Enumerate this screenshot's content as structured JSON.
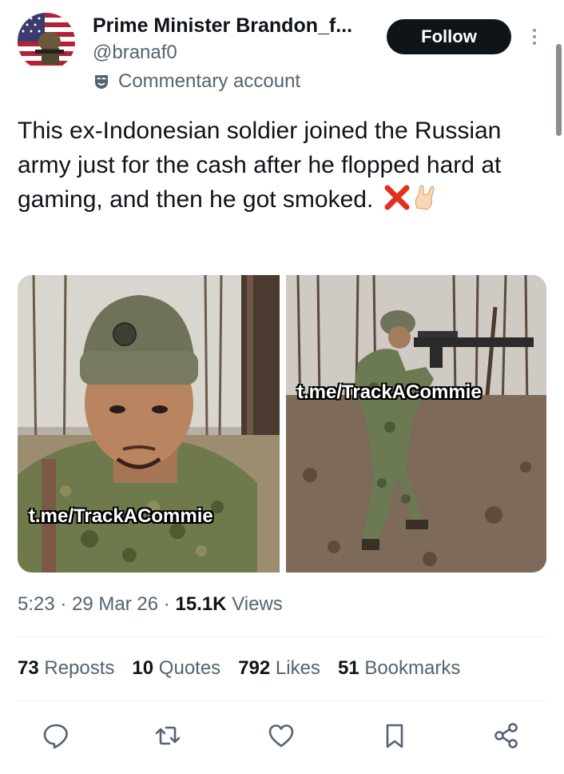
{
  "author": {
    "display_name": "Prime Minister Brandon_f...",
    "handle": "@branaf0",
    "label": "Commentary account"
  },
  "follow_label": "Follow",
  "tweet": {
    "text": "This ex-Indonesian soldier joined the Russian army just for the cash after he flopped hard at gaming, and then he got smoked."
  },
  "media": {
    "watermark_left": "t.me/TrackACommie",
    "watermark_right": "t.me/TrackACommie"
  },
  "meta": {
    "time": "5:23",
    "date": "29 Mar 26",
    "views_count": "15.1K",
    "views_label": "Views"
  },
  "stats": {
    "reposts_count": "73",
    "reposts_label": "Reposts",
    "quotes_count": "10",
    "quotes_label": "Quotes",
    "likes_count": "792",
    "likes_label": "Likes",
    "bookmarks_count": "51",
    "bookmarks_label": "Bookmarks"
  },
  "icons": [
    "reply-icon",
    "repost-icon",
    "like-icon",
    "bookmark-icon",
    "share-icon"
  ],
  "colors": {
    "text": "#0f1419",
    "secondary": "#536471",
    "follow_bg": "#0f1419"
  }
}
